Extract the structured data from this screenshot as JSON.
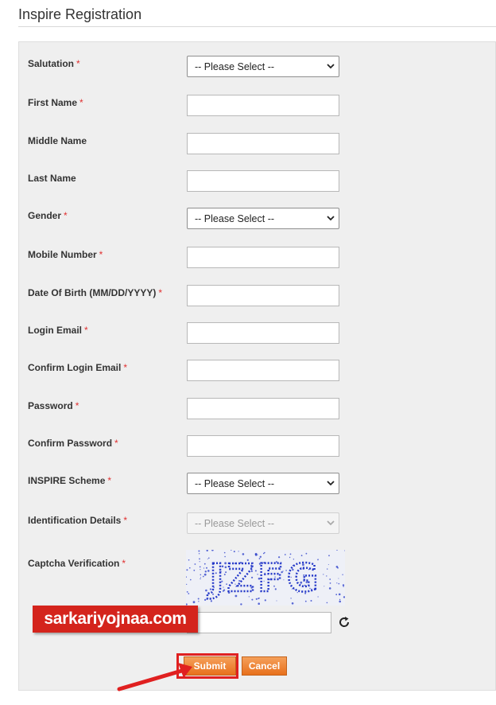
{
  "page": {
    "title": "Inspire Registration"
  },
  "form": {
    "fields": [
      {
        "label": "Salutation",
        "required": "*",
        "type": "select",
        "value": "-- Please Select --"
      },
      {
        "label": "First Name",
        "required": "*",
        "type": "text",
        "value": ""
      },
      {
        "label": "Middle Name",
        "required": "",
        "type": "text",
        "value": ""
      },
      {
        "label": "Last Name",
        "required": "",
        "type": "text",
        "value": ""
      },
      {
        "label": "Gender",
        "required": "*",
        "type": "select",
        "value": "-- Please Select --"
      },
      {
        "label": "Mobile Number",
        "required": "*",
        "type": "text",
        "value": ""
      },
      {
        "label": "Date Of Birth (MM/DD/YYYY)",
        "required": "*",
        "type": "text",
        "value": ""
      },
      {
        "label": "Login Email",
        "required": "*",
        "type": "text",
        "value": ""
      },
      {
        "label": "Confirm Login Email",
        "required": "*",
        "type": "text",
        "value": ""
      },
      {
        "label": "Password",
        "required": "*",
        "type": "text",
        "value": ""
      },
      {
        "label": "Confirm Password",
        "required": "*",
        "type": "text",
        "value": ""
      },
      {
        "label": "INSPIRE Scheme",
        "required": "*",
        "type": "select",
        "value": "-- Please Select --"
      },
      {
        "label": "Identification Details",
        "required": "*",
        "type": "select",
        "value": "-- Please Select --",
        "disabled": true
      }
    ],
    "captcha": {
      "label": "Captcha Verification",
      "required": "*",
      "image_text": "JZFG",
      "input_value": ""
    },
    "buttons": {
      "submit": "Submit",
      "cancel": "Cancel"
    }
  },
  "watermark": {
    "text": "sarkariyojnaa.com"
  },
  "colors": {
    "required": "#e03030",
    "button": "#e8701c",
    "watermark": "#d4241c",
    "captcha_text": "#2438c8"
  },
  "icons": {
    "refresh": "refresh-icon",
    "select_arrow": "chevron-down-icon",
    "pointer": "red-arrow-icon"
  }
}
